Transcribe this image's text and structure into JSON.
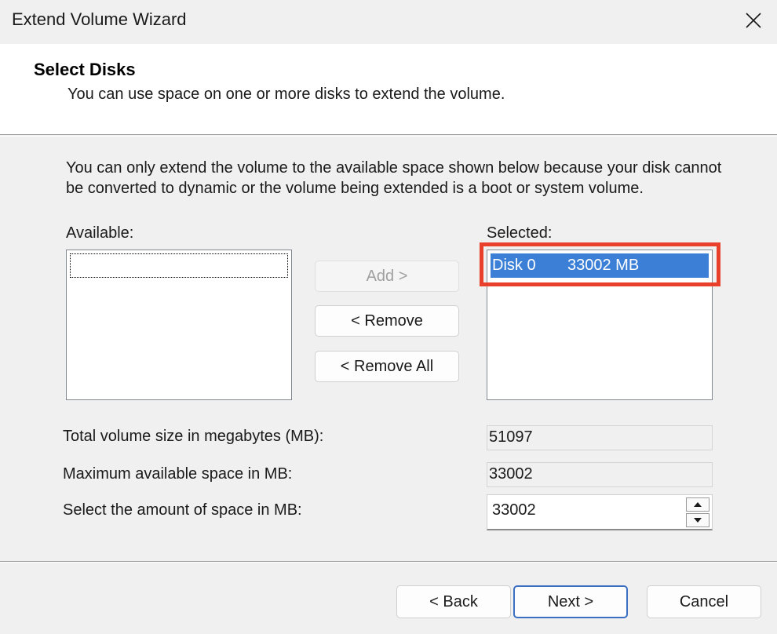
{
  "window": {
    "title": "Extend Volume Wizard",
    "close_icon": "close-icon"
  },
  "header": {
    "title": "Select Disks",
    "subtitle": "You can use space on one or more disks to extend the volume."
  },
  "description": "You can only extend the volume to the available space shown below because your disk cannot be converted to dynamic or the volume being extended is a boot or system volume.",
  "available": {
    "label": "Available:",
    "items": []
  },
  "selected": {
    "label": "Selected:",
    "items": [
      {
        "disk": "Disk 0",
        "size": "33002 MB"
      }
    ]
  },
  "buttons": {
    "add": "Add >",
    "remove": "< Remove",
    "remove_all": "< Remove All"
  },
  "fields": {
    "total_label": "Total volume size in megabytes (MB):",
    "total_value": "51097",
    "max_label": "Maximum available space in MB:",
    "max_value": "33002",
    "amount_label": "Select the amount of space in MB:",
    "amount_value": "33002"
  },
  "footer": {
    "back": "< Back",
    "next": "Next >",
    "cancel": "Cancel"
  },
  "colors": {
    "selection": "#3c7fd6",
    "highlight": "#e8402a"
  }
}
